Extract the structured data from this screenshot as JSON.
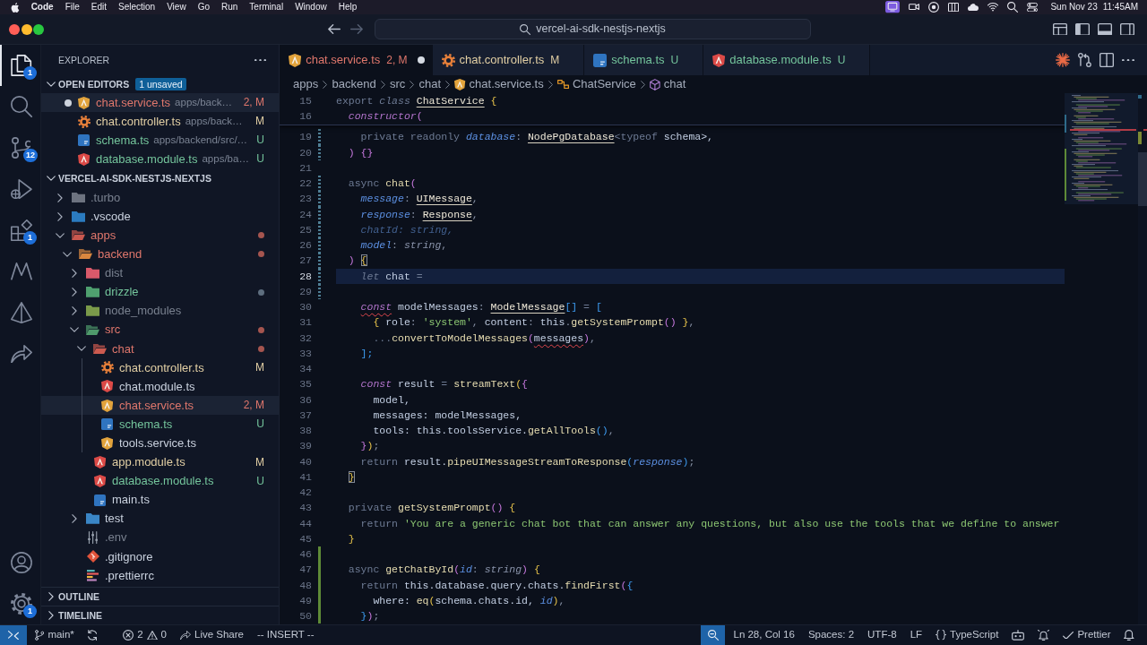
{
  "menubar": {
    "app": "Code",
    "menus": [
      "File",
      "Edit",
      "Selection",
      "View",
      "Go",
      "Run",
      "Terminal",
      "Window",
      "Help"
    ],
    "status_icons": [
      {
        "kind": "screen",
        "active": true
      },
      {
        "kind": "video",
        "active": false
      },
      {
        "kind": "ring",
        "active": false
      },
      {
        "kind": "columns",
        "active": false
      },
      {
        "kind": "cloud",
        "active": false
      },
      {
        "kind": "wifi",
        "active": false
      },
      {
        "kind": "search",
        "active": false
      },
      {
        "kind": "toggles",
        "active": false
      }
    ],
    "date": "Sun Nov 23",
    "time": "11:45AM"
  },
  "titlebar": {
    "nav": [
      {
        "kind": "back",
        "disabled": false
      },
      {
        "kind": "forward",
        "disabled": true
      }
    ],
    "search": "vercel-ai-sdk-nestjs-nextjs",
    "layout_icons": [
      {
        "kind": "layout"
      },
      {
        "kind": "sidebar-left"
      },
      {
        "kind": "panel"
      },
      {
        "kind": "sidebar-right"
      }
    ]
  },
  "activity_bar": {
    "top": [
      {
        "kind": "files",
        "selected": true,
        "badge": "1"
      },
      {
        "kind": "search",
        "selected": false
      },
      {
        "kind": "source-control",
        "selected": false,
        "badge": "12"
      },
      {
        "kind": "run-debug",
        "selected": false
      },
      {
        "kind": "extensions",
        "selected": false,
        "badge": "1"
      },
      {
        "kind": "nx",
        "selected": false
      },
      {
        "kind": "prism",
        "selected": false
      },
      {
        "kind": "live-share",
        "selected": false
      }
    ],
    "bottom": [
      {
        "kind": "account"
      },
      {
        "kind": "settings",
        "badge": "1"
      }
    ]
  },
  "explorer": {
    "title": "EXPLORER",
    "open_editors": {
      "title": "OPEN EDITORS",
      "badge": "1 unsaved",
      "expanded": true,
      "items": [
        {
          "name": "chat.service.ts",
          "path": "apps/back…",
          "decoration": "2, M",
          "kind": "service",
          "color": "#e0776c",
          "dirty": true,
          "selected": true
        },
        {
          "name": "chat.controller.ts",
          "path": "apps/back…",
          "decoration": "M",
          "kind": "gear",
          "color": "#e2cfa4",
          "dirty": false,
          "selected": false
        },
        {
          "name": "schema.ts",
          "path": "apps/backend/src/…",
          "decoration": "U",
          "kind": "ts",
          "color": "#74c59c",
          "dirty": false,
          "selected": false
        },
        {
          "name": "database.module.ts",
          "path": "apps/ba…",
          "decoration": "U",
          "kind": "module",
          "color": "#74c59c",
          "dirty": false,
          "selected": false
        }
      ]
    },
    "project": {
      "title": "VERCEL-AI-SDK-NESTJS-NEXTJS",
      "expanded": true,
      "tree": [
        {
          "name": ".turbo",
          "kind": "folder",
          "color": "#79818f",
          "icon": {
            "color": "#6d7380"
          },
          "expanded": false,
          "selected": false
        },
        {
          "name": ".vscode",
          "kind": "folder",
          "color": "#c9d1de",
          "icon": {
            "color": "#2b7bc0"
          },
          "expanded": false,
          "selected": false
        },
        {
          "name": "apps",
          "kind": "folder",
          "color": "#e0776c",
          "icon": {
            "color": "#c9584f"
          },
          "expanded": true,
          "selected": false,
          "dot": {
            "color": "#a5554f"
          },
          "children": [
            {
              "name": "backend",
              "kind": "folder",
              "color": "#e0776c",
              "icon": {
                "color": "#d9873f"
              },
              "expanded": true,
              "selected": false,
              "dot": {
                "color": "#a5554f"
              },
              "children": [
                {
                  "name": "dist",
                  "kind": "folder",
                  "color": "#79818f",
                  "icon": {
                    "color": "#d9596a"
                  },
                  "expanded": false,
                  "selected": false
                },
                {
                  "name": "drizzle",
                  "kind": "folder",
                  "color": "#74c59c",
                  "icon": {
                    "color": "#4fa06f"
                  },
                  "expanded": false,
                  "selected": false,
                  "dot": {
                    "color": "#5e6e7f"
                  }
                },
                {
                  "name": "node_modules",
                  "kind": "folder",
                  "color": "#79818f",
                  "icon": {
                    "color": "#7a9a4a"
                  },
                  "expanded": false,
                  "selected": false
                },
                {
                  "name": "src",
                  "kind": "folder",
                  "color": "#e0776c",
                  "icon": {
                    "color": "#4f9a6b"
                  },
                  "expanded": true,
                  "selected": false,
                  "dot": {
                    "color": "#a5554f"
                  },
                  "children": [
                    {
                      "name": "chat",
                      "kind": "folder",
                      "color": "#e0776c",
                      "icon": {
                        "color": "#cc5a4f"
                      },
                      "expanded": true,
                      "selected": false,
                      "dot": {
                        "color": "#a5554f"
                      },
                      "children": [
                        {
                          "name": "chat.controller.ts",
                          "kind": "gear",
                          "color": "#e2cfa4",
                          "decoration": "M",
                          "selected": false
                        },
                        {
                          "name": "chat.module.ts",
                          "kind": "module",
                          "color": "#c9d1de",
                          "selected": false
                        },
                        {
                          "name": "chat.service.ts",
                          "kind": "service",
                          "color": "#e0776c",
                          "decoration": "2, M",
                          "selected": true
                        },
                        {
                          "name": "schema.ts",
                          "kind": "ts",
                          "color": "#74c59c",
                          "decoration": "U",
                          "selected": false
                        },
                        {
                          "name": "tools.service.ts",
                          "kind": "service",
                          "color": "#c9d1de",
                          "selected": false
                        }
                      ]
                    },
                    {
                      "name": "app.module.ts",
                      "kind": "module",
                      "color": "#e2cfa4",
                      "decoration": "M",
                      "selected": false
                    },
                    {
                      "name": "database.module.ts",
                      "kind": "module",
                      "color": "#74c59c",
                      "decoration": "U",
                      "selected": false
                    },
                    {
                      "name": "main.ts",
                      "kind": "ts",
                      "color": "#c9d1de",
                      "selected": false
                    }
                  ]
                },
                {
                  "name": "test",
                  "kind": "folder",
                  "color": "#c9d1de",
                  "icon": {
                    "color": "#3a86c6"
                  },
                  "expanded": false,
                  "selected": false
                },
                {
                  "name": ".env",
                  "kind": "sliders",
                  "color": "#79818f",
                  "selected": false
                },
                {
                  "name": ".gitignore",
                  "kind": "git",
                  "color": "#c9d1de",
                  "selected": false
                },
                {
                  "name": ".prettierrc",
                  "kind": "prettier",
                  "color": "#c9d1de",
                  "selected": false
                }
              ]
            }
          ]
        }
      ]
    },
    "outline": {
      "title": "OUTLINE",
      "expanded": false
    },
    "timeline": {
      "title": "TIMELINE",
      "expanded": false
    }
  },
  "tabs": [
    {
      "label": "chat.service.ts",
      "kind": "service",
      "color": "#e0776c",
      "decoration": "2, M",
      "dirty": true,
      "selected": true
    },
    {
      "label": "chat.controller.ts",
      "kind": "gear",
      "color": "#e2cfa4",
      "decoration": "M",
      "dirty": false,
      "selected": false
    },
    {
      "label": "schema.ts",
      "kind": "ts",
      "color": "#74c59c",
      "decoration": "U",
      "dirty": false,
      "selected": false
    },
    {
      "label": "database.module.ts",
      "kind": "module",
      "color": "#74c59c",
      "decoration": "U",
      "dirty": false,
      "selected": false
    }
  ],
  "editor_actions": [
    {
      "kind": "sparkle"
    },
    {
      "kind": "compare"
    },
    {
      "kind": "split"
    },
    {
      "kind": "more"
    }
  ],
  "breadcrumbs": [
    {
      "label": "apps",
      "kind": "folder"
    },
    {
      "label": "backend",
      "kind": "folder"
    },
    {
      "label": "src",
      "kind": "folder"
    },
    {
      "label": "chat",
      "kind": "folder"
    },
    {
      "label": "chat.service.ts",
      "kind": "service"
    },
    {
      "label": "ChatService",
      "kind": "class"
    },
    {
      "label": "chat",
      "kind": "method"
    }
  ],
  "editor": {
    "sticky": [
      {
        "number": "15",
        "tokens": [
          {
            "kind": "keyword",
            "text": "export "
          },
          {
            "kind": "modifier",
            "text": "class "
          },
          {
            "kind": "type",
            "text": "ChatService",
            "underline": true
          },
          {
            "kind": "bracket1",
            "text": " {"
          }
        ]
      },
      {
        "number": "16",
        "tokens": [
          {
            "kind": "storage",
            "text": "  constructor"
          },
          {
            "kind": "bracket2",
            "text": "("
          }
        ]
      }
    ],
    "lines": [
      {
        "number": "19",
        "changed": true,
        "added": false,
        "current": false,
        "tokens": [
          {
            "kind": "keyword",
            "text": "    private readonly "
          },
          {
            "kind": "parameter",
            "text": "database"
          },
          {
            "kind": "punctuation",
            "text": ": "
          },
          {
            "kind": "type",
            "text": "NodePgDatabase",
            "underline": true
          },
          {
            "kind": "keyword",
            "text": "<typeof "
          },
          {
            "kind": "identifier",
            "text": "schema>,"
          }
        ]
      },
      {
        "number": "20",
        "changed": true,
        "added": false,
        "current": false,
        "tokens": [
          {
            "kind": "bracket2",
            "text": "  ) {}"
          }
        ]
      },
      {
        "number": "21",
        "changed": false,
        "added": false,
        "current": false
      },
      {
        "number": "22",
        "changed": true,
        "added": false,
        "current": false,
        "tokens": [
          {
            "kind": "keyword",
            "text": "  async "
          },
          {
            "kind": "function",
            "text": "chat"
          },
          {
            "kind": "bracket2",
            "text": "("
          }
        ]
      },
      {
        "number": "23",
        "changed": true,
        "added": false,
        "current": false,
        "tokens": [
          {
            "kind": "parameter",
            "text": "    message"
          },
          {
            "kind": "punctuation",
            "text": ": "
          },
          {
            "kind": "type",
            "text": "UIMessage",
            "underline": true
          },
          {
            "kind": "punctuation",
            "text": ","
          }
        ]
      },
      {
        "number": "24",
        "changed": true,
        "added": false,
        "current": false,
        "tokens": [
          {
            "kind": "parameter",
            "text": "    response"
          },
          {
            "kind": "punctuation",
            "text": ": "
          },
          {
            "kind": "type",
            "text": "Response",
            "underline": true
          },
          {
            "kind": "punctuation",
            "text": ","
          }
        ]
      },
      {
        "number": "25",
        "changed": true,
        "added": false,
        "current": false,
        "tokens": [
          {
            "kind": "unused",
            "text": "    chatId: string,"
          }
        ]
      },
      {
        "number": "26",
        "changed": true,
        "added": false,
        "current": false,
        "tokens": [
          {
            "kind": "parameter",
            "text": "    model"
          },
          {
            "kind": "punctuation",
            "text": ": "
          },
          {
            "kind": "primitive",
            "text": "string"
          },
          {
            "kind": "punctuation",
            "text": ","
          }
        ]
      },
      {
        "number": "27",
        "changed": true,
        "added": false,
        "current": false,
        "tokens": [
          {
            "kind": "bracket2",
            "text": "  ) "
          },
          {
            "kind": "bracket1",
            "text": "{",
            "matched": true
          }
        ]
      },
      {
        "number": "28",
        "changed": true,
        "added": false,
        "current": true,
        "tokens": [
          {
            "kind": "modifier",
            "text": "    let "
          },
          {
            "kind": "identifier",
            "text": "chat"
          },
          {
            "kind": "keyword",
            "text": " ="
          }
        ]
      },
      {
        "number": "29",
        "changed": true,
        "added": false,
        "current": false
      },
      {
        "number": "30",
        "changed": false,
        "added": false,
        "current": false,
        "tokens": [
          {
            "kind": "storage",
            "text": "    const",
            "squiggle": true
          },
          {
            "kind": "identifier",
            "text": " modelMessages"
          },
          {
            "kind": "punctuation",
            "text": ": "
          },
          {
            "kind": "type",
            "text": "ModelMessage",
            "underline": true
          },
          {
            "kind": "bracket3",
            "text": "[]"
          },
          {
            "kind": "keyword",
            "text": " = "
          },
          {
            "kind": "bracket3",
            "text": "["
          }
        ]
      },
      {
        "number": "31",
        "changed": false,
        "added": false,
        "current": false,
        "tokens": [
          {
            "kind": "bracket1",
            "text": "      { "
          },
          {
            "kind": "identifier",
            "text": "role"
          },
          {
            "kind": "punctuation",
            "text": ": "
          },
          {
            "kind": "string",
            "text": "'system'"
          },
          {
            "kind": "punctuation",
            "text": ", "
          },
          {
            "kind": "identifier",
            "text": "content"
          },
          {
            "kind": "punctuation",
            "text": ": "
          },
          {
            "kind": "identifier",
            "text": "this"
          },
          {
            "kind": "punctuation",
            "text": "."
          },
          {
            "kind": "function",
            "text": "getSystemPrompt"
          },
          {
            "kind": "bracket2",
            "text": "()"
          },
          {
            "kind": "bracket1",
            "text": " }"
          },
          {
            "kind": "punctuation",
            "text": ","
          }
        ]
      },
      {
        "number": "32",
        "changed": false,
        "added": false,
        "current": false,
        "tokens": [
          {
            "kind": "keyword",
            "text": "      ..."
          },
          {
            "kind": "function",
            "text": "convertToModelMessages"
          },
          {
            "kind": "bracket2",
            "text": "("
          },
          {
            "kind": "identifier",
            "text": "messages",
            "squiggle": true
          },
          {
            "kind": "bracket2",
            "text": ")"
          },
          {
            "kind": "punctuation",
            "text": ","
          }
        ]
      },
      {
        "number": "33",
        "changed": false,
        "added": false,
        "current": false,
        "tokens": [
          {
            "kind": "bracket3",
            "text": "    ];"
          }
        ]
      },
      {
        "number": "34",
        "changed": false,
        "added": false,
        "current": false
      },
      {
        "number": "35",
        "changed": false,
        "added": false,
        "current": false,
        "tokens": [
          {
            "kind": "storage",
            "text": "    const "
          },
          {
            "kind": "identifier",
            "text": "result"
          },
          {
            "kind": "keyword",
            "text": " = "
          },
          {
            "kind": "function",
            "text": "streamText"
          },
          {
            "kind": "bracket1",
            "text": "("
          },
          {
            "kind": "bracket2",
            "text": "{"
          }
        ]
      },
      {
        "number": "36",
        "changed": false,
        "added": false,
        "current": false,
        "tokens": [
          {
            "kind": "identifier",
            "text": "      model,"
          }
        ]
      },
      {
        "number": "37",
        "changed": false,
        "added": false,
        "current": false,
        "tokens": [
          {
            "kind": "identifier",
            "text": "      messages: modelMessages,"
          }
        ]
      },
      {
        "number": "38",
        "changed": false,
        "added": false,
        "current": false,
        "tokens": [
          {
            "kind": "identifier",
            "text": "      tools: this.toolsService."
          },
          {
            "kind": "function",
            "text": "getAllTools"
          },
          {
            "kind": "bracket3",
            "text": "()"
          },
          {
            "kind": "punctuation",
            "text": ","
          }
        ]
      },
      {
        "number": "39",
        "changed": false,
        "added": false,
        "current": false,
        "tokens": [
          {
            "kind": "bracket2",
            "text": "    }"
          },
          {
            "kind": "bracket1",
            "text": ")"
          },
          {
            "kind": "punctuation",
            "text": ";"
          }
        ]
      },
      {
        "number": "40",
        "changed": false,
        "added": false,
        "current": false,
        "tokens": [
          {
            "kind": "keyword",
            "text": "    return "
          },
          {
            "kind": "identifier",
            "text": "result."
          },
          {
            "kind": "function",
            "text": "pipeUIMessageStreamToResponse"
          },
          {
            "kind": "bracket3",
            "text": "("
          },
          {
            "kind": "parameter",
            "text": "response"
          },
          {
            "kind": "bracket3",
            "text": ")"
          },
          {
            "kind": "punctuation",
            "text": ";"
          }
        ]
      },
      {
        "number": "41",
        "changed": false,
        "added": false,
        "current": false,
        "tokens": [
          {
            "kind": "bracket1",
            "text": "  }",
            "matched": true
          }
        ]
      },
      {
        "number": "42",
        "changed": false,
        "added": false,
        "current": false
      },
      {
        "number": "43",
        "changed": false,
        "added": false,
        "current": false,
        "tokens": [
          {
            "kind": "keyword",
            "text": "  private "
          },
          {
            "kind": "function",
            "text": "getSystemPrompt"
          },
          {
            "kind": "bracket2",
            "text": "() "
          },
          {
            "kind": "bracket1",
            "text": "{"
          }
        ]
      },
      {
        "number": "44",
        "changed": false,
        "added": false,
        "current": false,
        "tokens": [
          {
            "kind": "keyword",
            "text": "    return "
          },
          {
            "kind": "string",
            "text": "'You are a generic chat bot that can answer any questions, but also use the tools that we define to answer"
          }
        ]
      },
      {
        "number": "45",
        "changed": false,
        "added": false,
        "current": false,
        "tokens": [
          {
            "kind": "bracket1",
            "text": "  }"
          }
        ]
      },
      {
        "number": "46",
        "changed": false,
        "added": true,
        "current": false
      },
      {
        "number": "47",
        "changed": false,
        "added": true,
        "current": false,
        "tokens": [
          {
            "kind": "keyword",
            "text": "  async "
          },
          {
            "kind": "function",
            "text": "getChatById"
          },
          {
            "kind": "bracket2",
            "text": "("
          },
          {
            "kind": "parameter",
            "text": "id"
          },
          {
            "kind": "punctuation",
            "text": ": "
          },
          {
            "kind": "primitive",
            "text": "string"
          },
          {
            "kind": "bracket2",
            "text": ")"
          },
          {
            "kind": "bracket1",
            "text": " {"
          }
        ]
      },
      {
        "number": "48",
        "changed": false,
        "added": true,
        "current": false,
        "tokens": [
          {
            "kind": "keyword",
            "text": "    return "
          },
          {
            "kind": "identifier",
            "text": "this.database.query.chats."
          },
          {
            "kind": "function",
            "text": "findFirst"
          },
          {
            "kind": "bracket2",
            "text": "("
          },
          {
            "kind": "bracket3",
            "text": "{"
          }
        ]
      },
      {
        "number": "49",
        "changed": false,
        "added": true,
        "current": false,
        "tokens": [
          {
            "kind": "identifier",
            "text": "      where: "
          },
          {
            "kind": "function",
            "text": "eq"
          },
          {
            "kind": "bracket1",
            "text": "("
          },
          {
            "kind": "identifier",
            "text": "schema.chats.id, "
          },
          {
            "kind": "parameter",
            "text": "id"
          },
          {
            "kind": "bracket1",
            "text": ")"
          },
          {
            "kind": "punctuation",
            "text": ","
          }
        ]
      },
      {
        "number": "50",
        "changed": false,
        "added": true,
        "current": false,
        "tokens": [
          {
            "kind": "bracket3",
            "text": "    }"
          },
          {
            "kind": "bracket2",
            "text": ")"
          },
          {
            "kind": "punctuation",
            "text": ";"
          }
        ]
      }
    ]
  },
  "status_bar": {
    "left": [
      {
        "kind": "remote"
      },
      {
        "kind": "branch",
        "label": "main*"
      },
      {
        "kind": "sync"
      },
      {
        "kind": "problems",
        "errors": "2",
        "warnings": "0"
      },
      {
        "kind": "live-share",
        "label": "Live Share"
      },
      {
        "kind": "text",
        "label": "-- INSERT --"
      }
    ],
    "right": [
      {
        "kind": "zoom"
      },
      {
        "kind": "text",
        "label": "Ln 28, Col 16"
      },
      {
        "kind": "text",
        "label": "Spaces: 2"
      },
      {
        "kind": "text",
        "label": "UTF-8"
      },
      {
        "kind": "text",
        "label": "LF"
      },
      {
        "kind": "language",
        "label": "TypeScript"
      },
      {
        "kind": "copilot"
      },
      {
        "kind": "alert"
      },
      {
        "kind": "check",
        "label": "Prettier"
      },
      {
        "kind": "bell"
      }
    ]
  }
}
